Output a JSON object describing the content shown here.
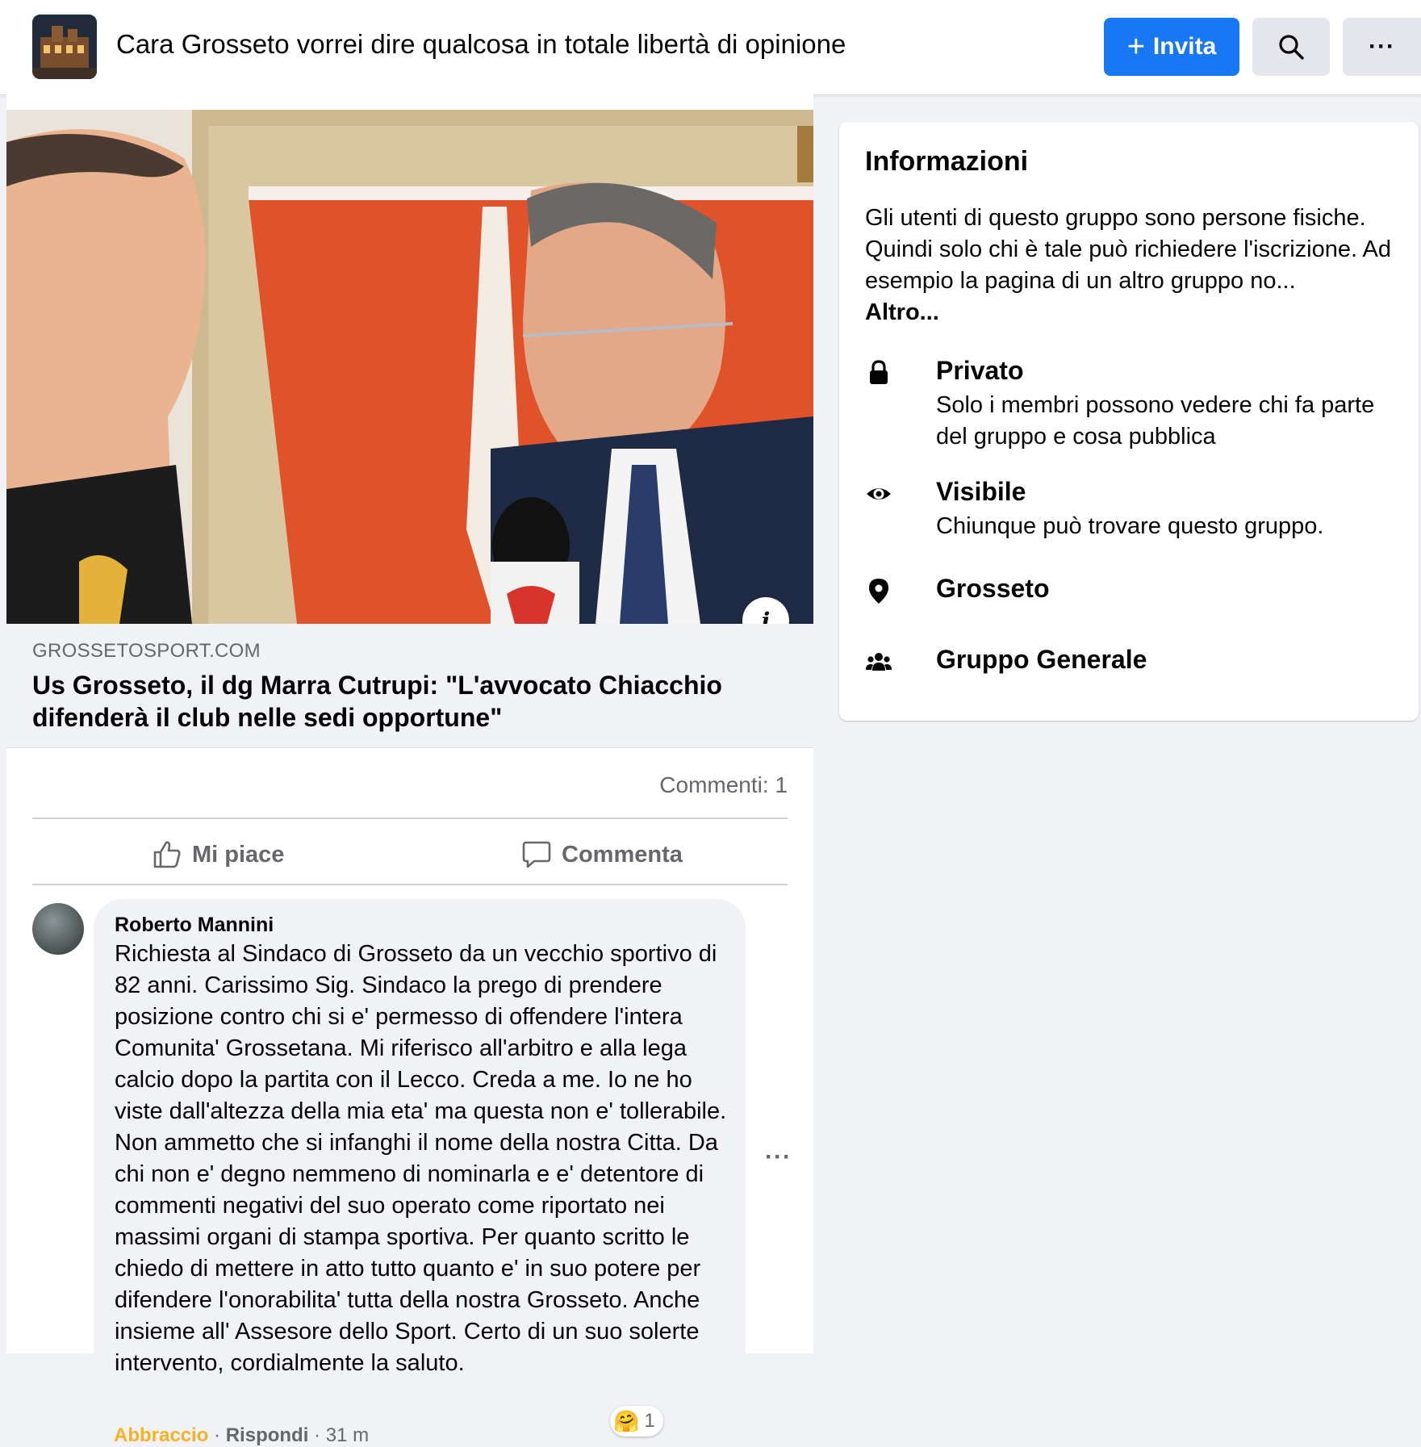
{
  "header": {
    "group_title": "Cara Grosseto vorrei dire qualcosa in totale libertà di opinione",
    "invite_label": "Invita",
    "invite_plus": "+",
    "more_label": "···"
  },
  "post": {
    "link_domain": "GROSSETOSPORT.COM",
    "link_title": "Us Grosseto, il dg Marra Cutrupi: \"L'avvocato Chiacchio difenderà il club nelle sedi opportune\"",
    "info_button": "i",
    "comments_count": "Commenti: 1",
    "like_label": "Mi piace",
    "comment_label": "Commenta"
  },
  "comment": {
    "author": "Roberto Mannini",
    "text": "Richiesta al Sindaco di Grosseto da un vecchio sportivo di 82 anni. Carissimo Sig. Sindaco la prego di prendere posizione contro chi si e' permesso di offendere l'intera Comunita' Grossetana. Mi riferisco all'arbitro e alla lega calcio dopo la partita con il Lecco. Creda a me. Io ne ho viste dall'altezza della mia eta' ma questa non e' tollerabile. Non ammetto che si infanghi il nome della nostra Citta. Da chi non e' degno nemmeno di nominarla e e' detentore di commenti negativi del suo operato come riportato nei massimi organi di stampa sportiva. Per quanto scritto le chiedo di mettere in atto tutto quanto e' in suo potere per difendere l'onorabilita' tutta della nostra Grosseto. Anche insieme all' Assesore dello Sport. Certo di un suo solerte intervento, cordialmente la saluto.",
    "reaction_count": "1",
    "reaction_emoji": "🤗",
    "hug_label": "Abbraccio",
    "separator": "·",
    "reply_label": "Rispondi",
    "time": "31 m",
    "more_label": "···"
  },
  "info": {
    "heading": "Informazioni",
    "description": "Gli utenti di questo gruppo sono persone fisiche. Quindi solo chi è tale può richiedere l'iscrizione. Ad esempio la pagina di un altro gruppo no...",
    "more_link": "Altro...",
    "private_label": "Privato",
    "private_sub": "Solo i membri possono vedere chi fa parte del gruppo e cosa pubblica",
    "visible_label": "Visibile",
    "visible_sub": "Chiunque può trovare questo gruppo.",
    "location_label": "Grosseto",
    "type_label": "Gruppo Generale"
  },
  "colors": {
    "accent": "#1877f2",
    "background": "#f0f2f5",
    "secondary_text": "#65676b",
    "hug_reaction": "#f7b125"
  },
  "icons": [
    "search-icon",
    "more-icon",
    "plus-icon",
    "like-icon",
    "comment-icon",
    "lock-icon",
    "eye-icon",
    "location-pin-icon",
    "group-icon",
    "info-icon"
  ]
}
